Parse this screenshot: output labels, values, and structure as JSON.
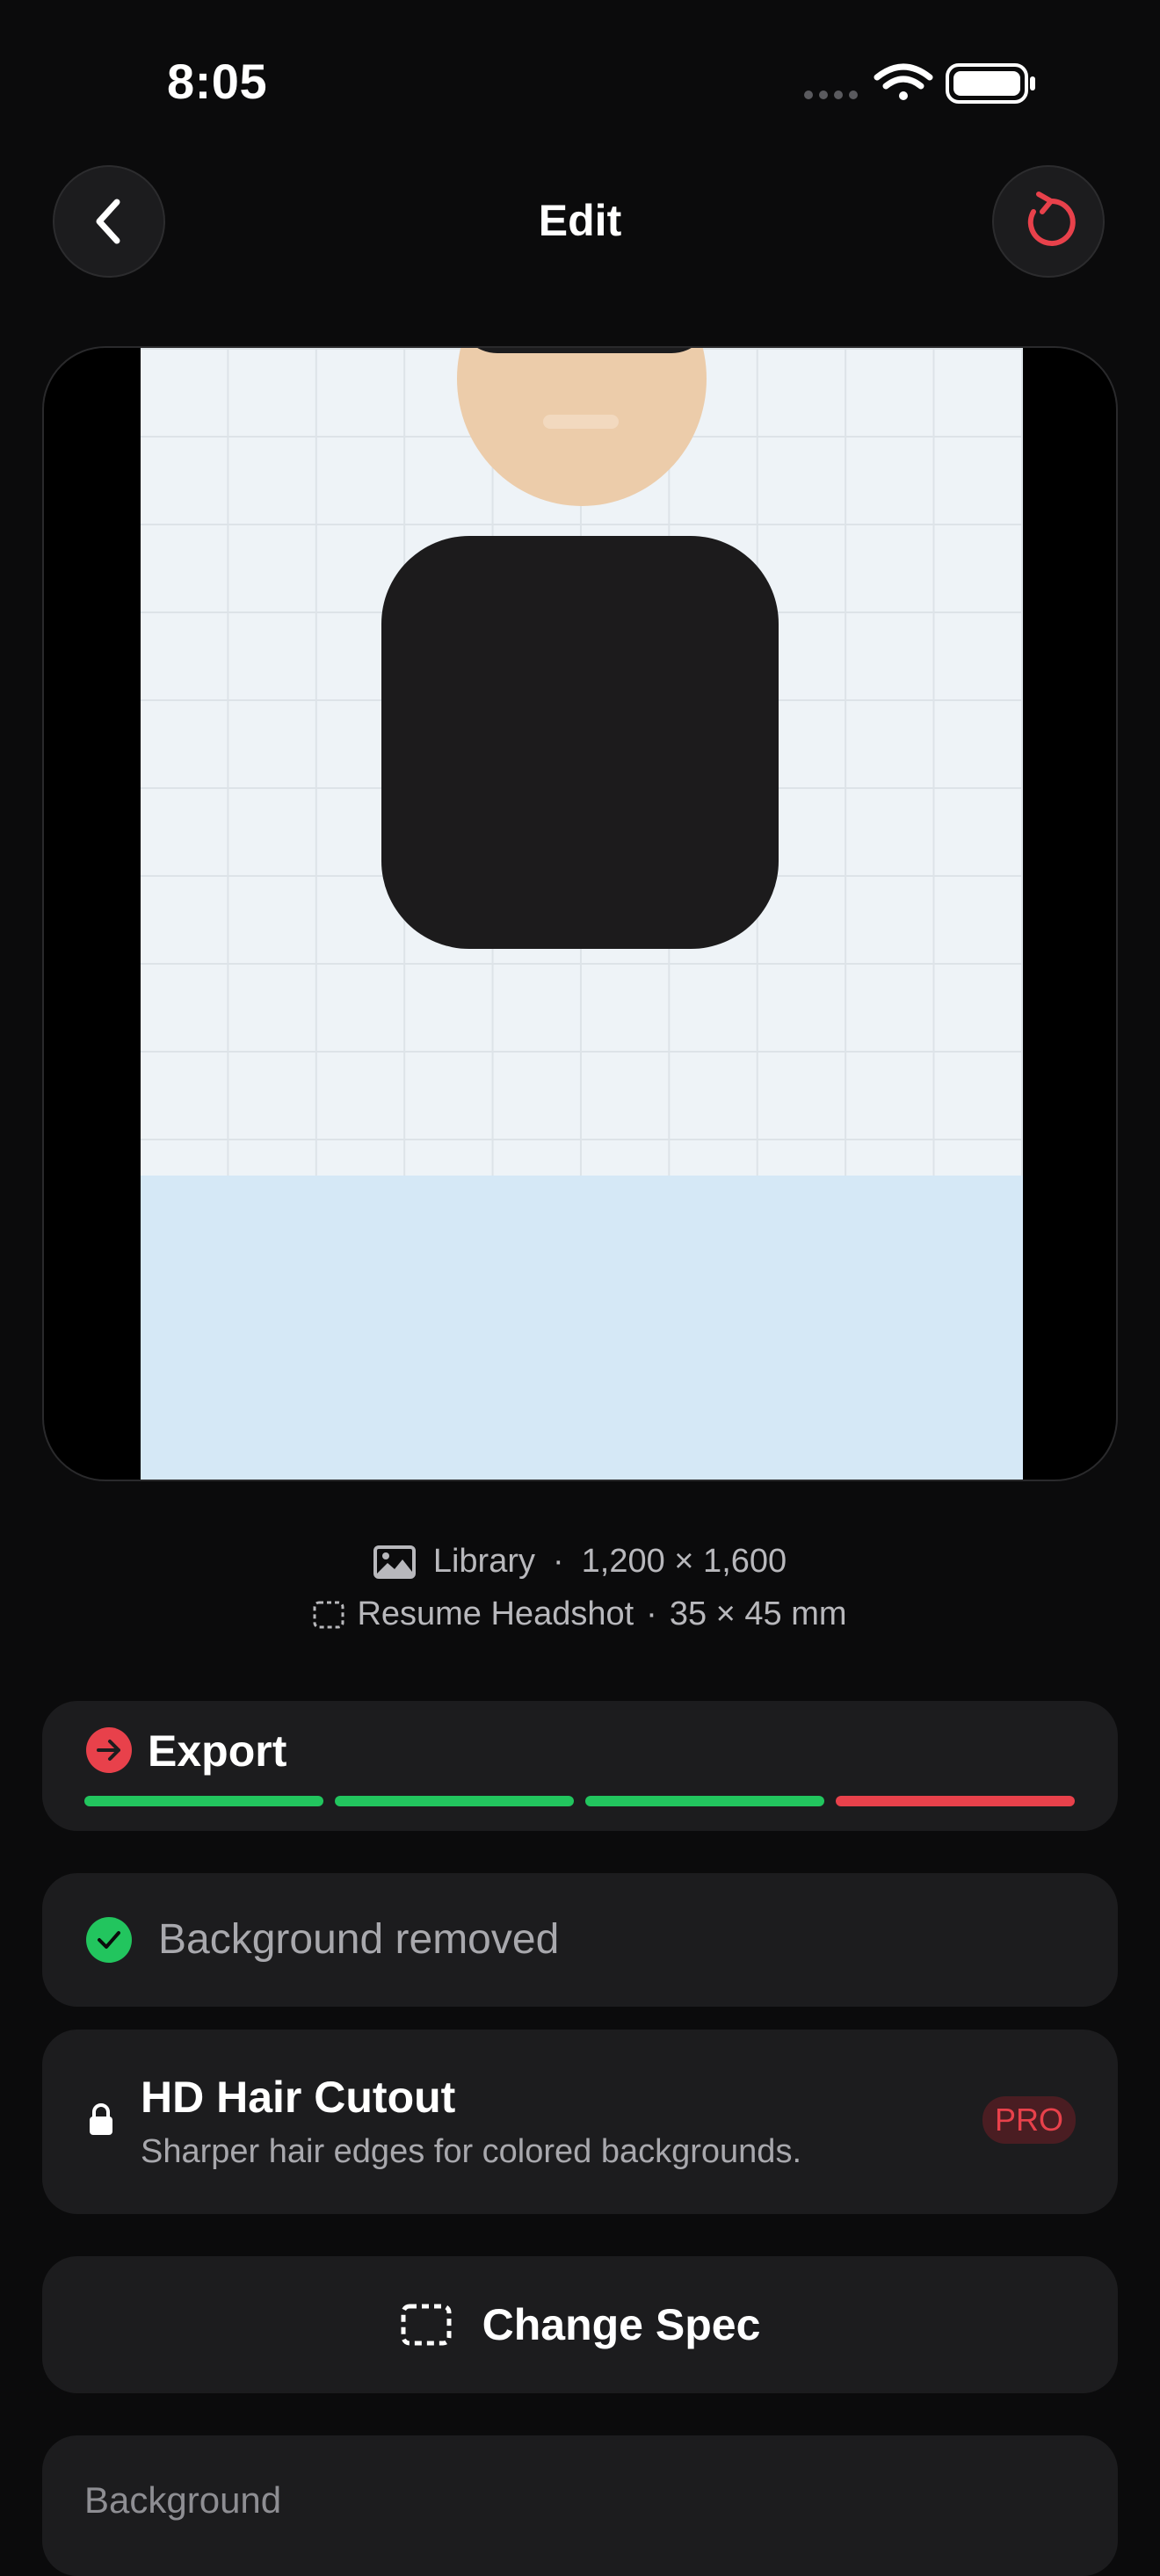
{
  "status_bar": {
    "time": "8:05",
    "icons": [
      "signal-dots-icon",
      "wifi-icon",
      "battery-icon"
    ]
  },
  "header": {
    "title": "Edit",
    "back_icon": "chevron-left-icon",
    "reset_icon": "reset-icon"
  },
  "preview": {
    "background_color": "#d5e8f6",
    "grid_color": "#eef3f7"
  },
  "info": {
    "source": "Library",
    "separator": "·",
    "dimensions": "1,200 × 1,600",
    "spec_name": "Resume Headshot",
    "spec_size": "35 × 45 mm"
  },
  "export": {
    "label": "Export",
    "progress_colors": [
      "#22c55e",
      "#22c55e",
      "#22c55e",
      "#e8414b"
    ],
    "completed_steps": 3,
    "total_steps": 4
  },
  "background_removed": {
    "label": "Background removed"
  },
  "hd_hair": {
    "title": "HD Hair Cutout",
    "subtitle": "Sharper hair edges for colored backgrounds.",
    "badge": "PRO"
  },
  "change_spec": {
    "label": "Change Spec"
  },
  "background_section": {
    "label": "Background"
  },
  "colors": {
    "accent_red": "#e8414b",
    "success_green": "#22c55e",
    "card_bg": "#1c1c1e",
    "page_bg": "#0b0b0c"
  }
}
